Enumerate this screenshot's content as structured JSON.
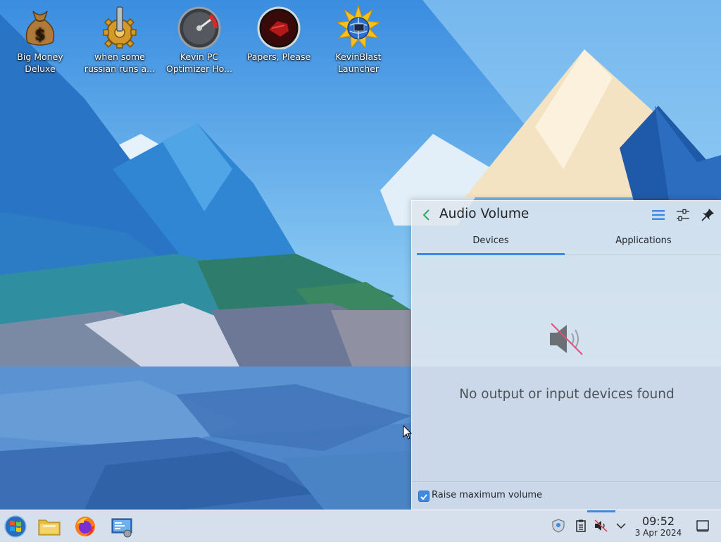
{
  "desktop": {
    "icons": [
      {
        "label": "Big Money Deluxe",
        "icon": "money-bag-icon"
      },
      {
        "label": "when some russian runs a...",
        "icon": "gear-icon"
      },
      {
        "label": "Kevin PC Optimizer Ho...",
        "icon": "speedometer-icon"
      },
      {
        "label": "Papers, Please",
        "icon": "papers-please-icon"
      },
      {
        "label": "KevinBlast Launcher",
        "icon": "starburst-globe-icon"
      }
    ]
  },
  "audio_panel": {
    "title": "Audio Volume",
    "tabs": [
      {
        "label": "Devices",
        "active": true
      },
      {
        "label": "Applications",
        "active": false
      }
    ],
    "empty_message": "No output or input devices found",
    "raise_max_volume_label": "Raise maximum volume",
    "raise_max_volume_checked": true,
    "accent_color": "#3d8ae4"
  },
  "taskbar": {
    "launchers": [
      "start-menu-icon",
      "file-manager-icon",
      "firefox-icon",
      "system-settings-icon"
    ],
    "tray": [
      "vault-icon",
      "clipboard-icon",
      "volume-muted-icon",
      "expand-tray-icon"
    ],
    "clock": {
      "time": "09:52",
      "date": "3 Apr 2024"
    }
  }
}
